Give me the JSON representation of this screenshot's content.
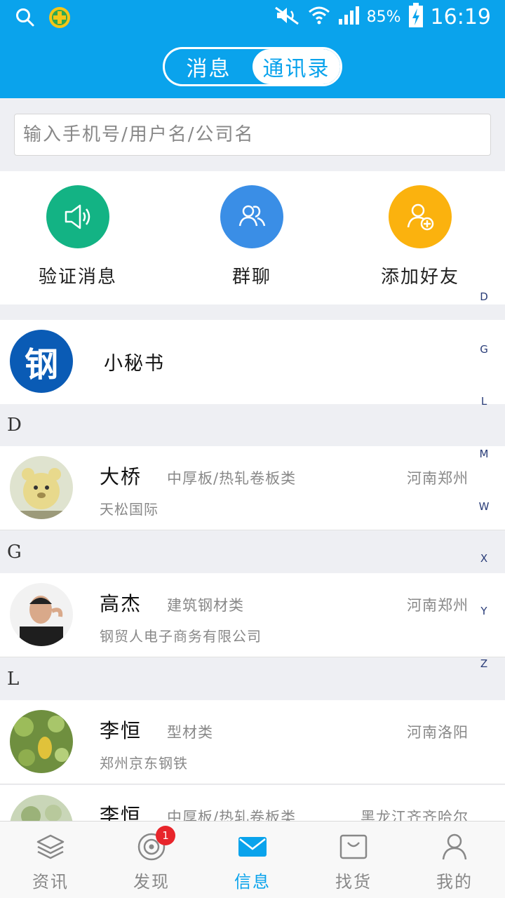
{
  "status_bar": {
    "battery": "85%",
    "time": "16:19"
  },
  "header": {
    "tabs": [
      {
        "label": "消息",
        "active": false
      },
      {
        "label": "通讯录",
        "active": true
      }
    ]
  },
  "search": {
    "placeholder": "输入手机号/用户名/公司名"
  },
  "shortcuts": [
    {
      "label": "验证消息",
      "icon": "speaker-icon",
      "color": "#13b384"
    },
    {
      "label": "群聊",
      "icon": "group-icon",
      "color": "#3a8ee6"
    },
    {
      "label": "添加好友",
      "icon": "add-friend-icon",
      "color": "#fbb20e"
    }
  ],
  "alpha_index": [
    "D",
    "G",
    "L",
    "M",
    "W",
    "X",
    "Y",
    "Z"
  ],
  "secretary": {
    "logo_text": "钢",
    "name": "小秘书"
  },
  "sections": [
    {
      "letter": "D",
      "contacts": [
        {
          "name": "大桥",
          "category": "中厚板/热轧卷板类",
          "location": "河南郑州",
          "company": "天松国际"
        }
      ]
    },
    {
      "letter": "G",
      "contacts": [
        {
          "name": "高杰",
          "category": "建筑钢材类",
          "location": "河南郑州",
          "company": "钢贸人电子商务有限公司"
        }
      ]
    },
    {
      "letter": "L",
      "contacts": [
        {
          "name": "李恒",
          "category": "型材类",
          "location": "河南洛阳",
          "company": "郑州京东钢铁"
        },
        {
          "name": "李恒",
          "category": "中厚板/热轧卷板类",
          "location": "黑龙江齐齐哈尔",
          "company": ""
        }
      ]
    }
  ],
  "bottom_nav": [
    {
      "label": "资讯",
      "active": false
    },
    {
      "label": "发现",
      "active": false,
      "badge": "1"
    },
    {
      "label": "信息",
      "active": true
    },
    {
      "label": "找货",
      "active": false
    },
    {
      "label": "我的",
      "active": false
    }
  ],
  "colors": {
    "primary": "#0aa3ec",
    "badge": "#e8252b"
  }
}
